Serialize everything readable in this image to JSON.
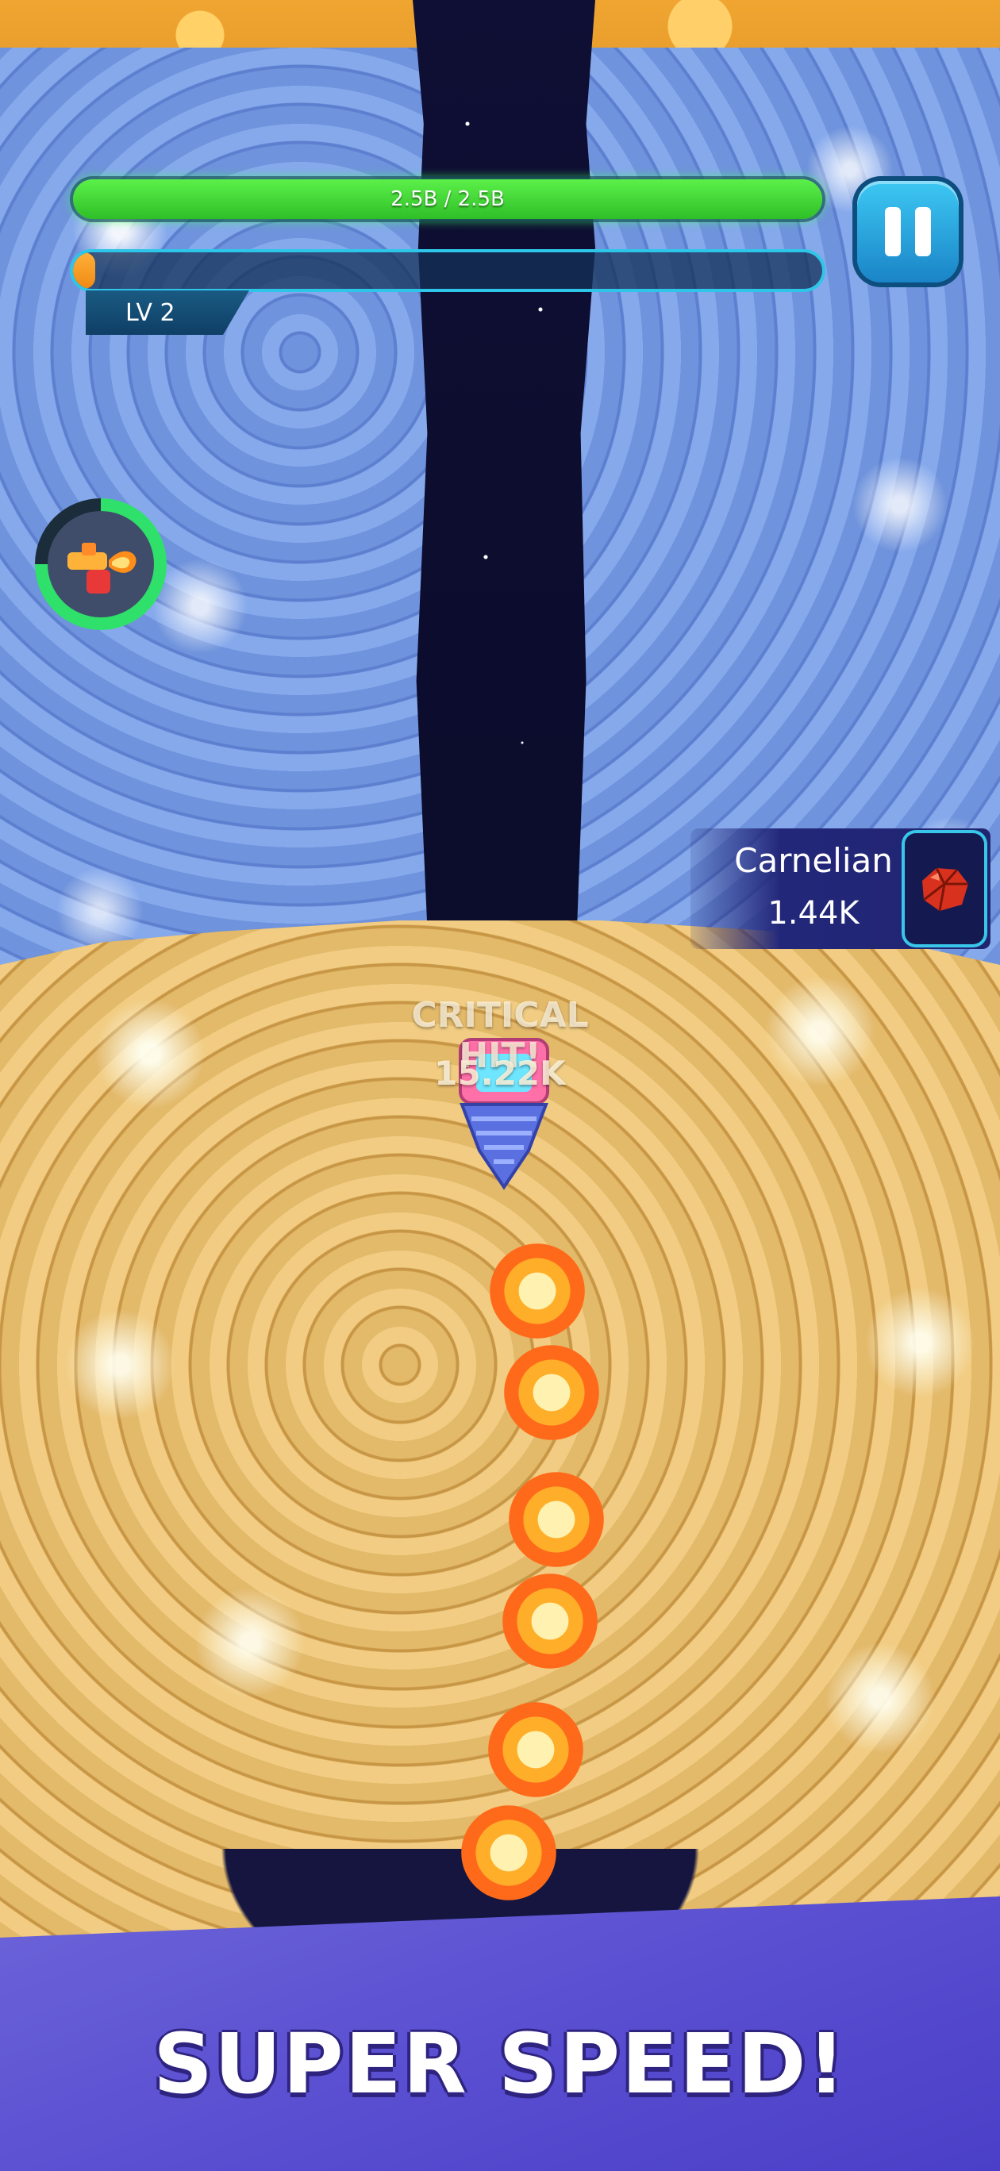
{
  "hud": {
    "health_label": "2.5B / 2.5B",
    "health_fraction": 1.0,
    "xp_fraction": 0.03,
    "level_label": "LV 2",
    "booster_progress": 0.75
  },
  "pickup": {
    "name": "Carnelian",
    "amount": "1.44K",
    "gem_icon": "carnelian-gem-icon"
  },
  "combat": {
    "critical_label": "CRITICAL HIT!",
    "damage_label": "15.22K"
  },
  "banner": {
    "title": "SUPER SPEED!"
  },
  "colors": {
    "health": "#3fd63a",
    "xp": "#f59a1c",
    "accent": "#2ec6e8",
    "banner": "#5a4fd1"
  }
}
